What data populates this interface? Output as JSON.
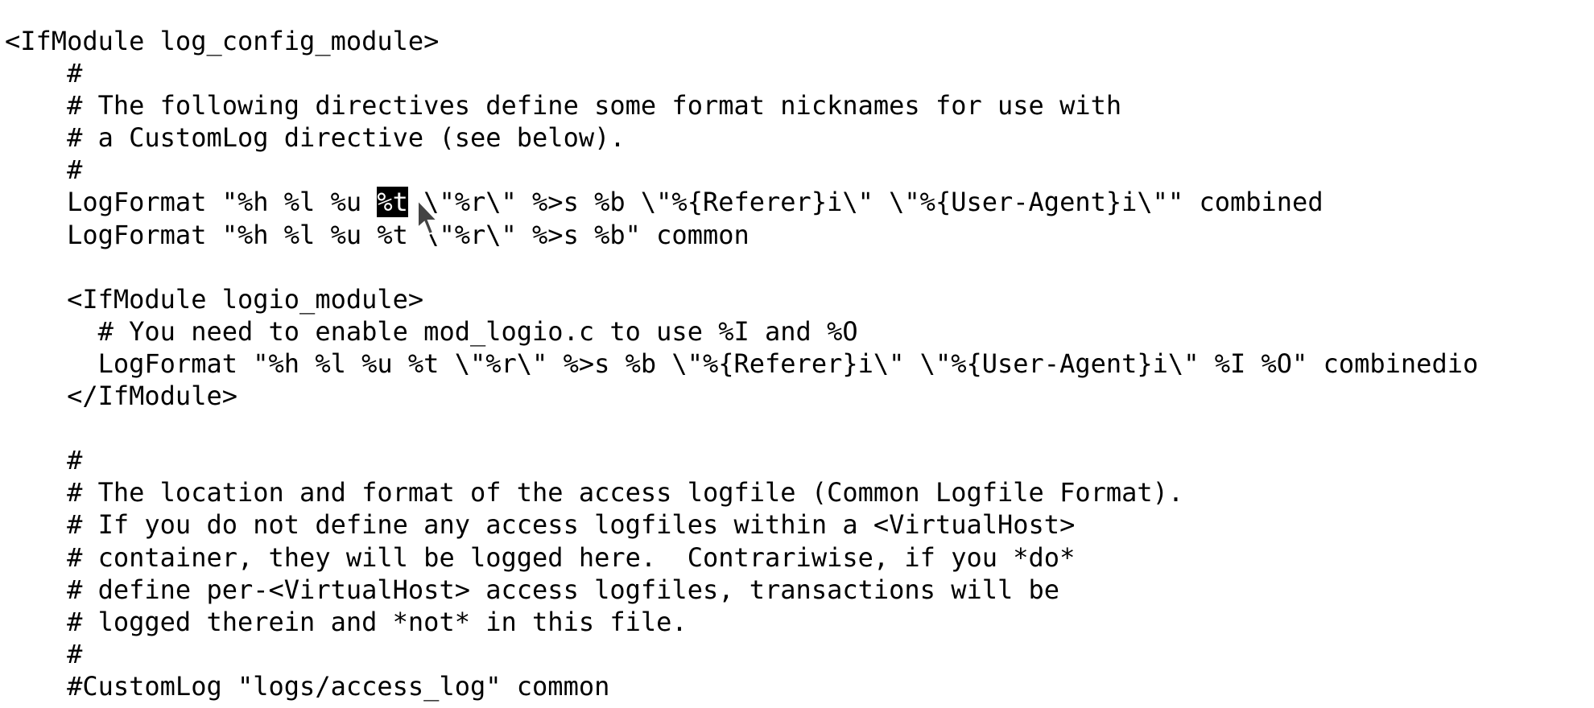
{
  "editor": {
    "lines": [
      "<IfModule log_config_module>",
      "    #",
      "    # The following directives define some format nicknames for use with",
      "    # a CustomLog directive (see below).",
      "    #",
      "",
      "    LogFormat \"%h %l %u %t \\\"%r\\\" %>s %b\" common",
      "",
      "    <IfModule logio_module>",
      "      # You need to enable mod_logio.c to use %I and %O",
      "      LogFormat \"%h %l %u %t \\\"%r\\\" %>s %b \\\"%{Referer}i\\\" \\\"%{User-Agent}i\\\" %I %O\" combinedio",
      "    </IfModule>",
      "",
      "    #",
      "    # The location and format of the access logfile (Common Logfile Format).",
      "    # If you do not define any access logfiles within a <VirtualHost>",
      "    # container, they will be logged here.  Contrariwise, if you *do*",
      "    # define per-<VirtualHost> access logfiles, transactions will be",
      "    # logged therein and *not* in this file.",
      "    #",
      "    #CustomLog \"logs/access_log\" common"
    ],
    "selected_line": {
      "before": "    LogFormat \"%h %l %u ",
      "selection": "%t",
      "after": " \\\"%r\\\" %>s %b \\\"%{Referer}i\\\" \\\"%{User-Agent}i\\\"\" combined"
    }
  }
}
